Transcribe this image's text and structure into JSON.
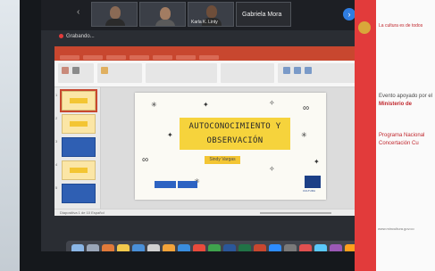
{
  "zoom": {
    "participants": [
      {
        "name": ""
      },
      {
        "name": ""
      },
      {
        "name": "Karla K. Linty"
      },
      {
        "name": "Gabriela Mora"
      }
    ],
    "recording_label": "Grabando..."
  },
  "powerpoint": {
    "slide": {
      "title_line1": "AUTOCONOCIMIENTO Y",
      "title_line2": "OBSERVACIÓN",
      "author": "Sindy Vargas",
      "logo_right_caption": "CULTURA"
    },
    "status_text": "Diapositiva 1 de 10   Español"
  },
  "poster": {
    "logo_caption": "La cultura es de todos",
    "line1": "Evento apoyado por el",
    "line2": "Ministerio de",
    "line3": "Programa Nacional",
    "line4": "Concertación Cu",
    "bottom": "www.mincultura.gov.co"
  },
  "colors": {
    "ppt_accent": "#c8472f",
    "slide_highlight": "#f6d33c",
    "zoom_blue": "#2f7de1",
    "poster_red": "#e23b3b"
  }
}
